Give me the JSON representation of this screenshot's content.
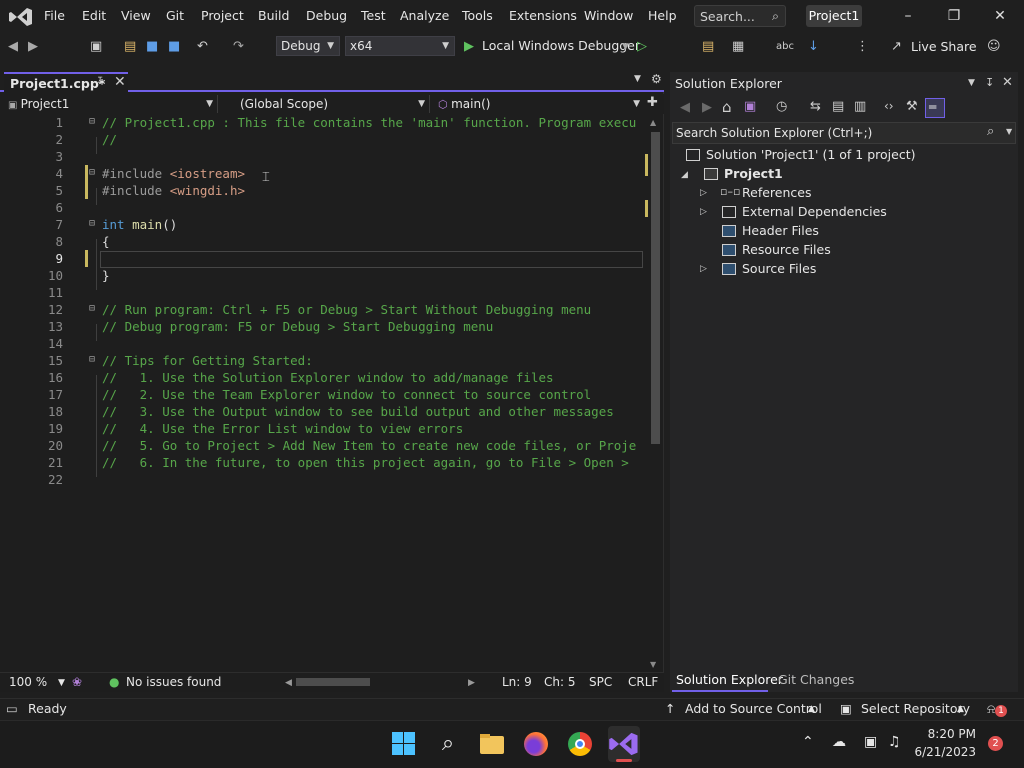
{
  "menu": [
    "File",
    "Edit",
    "View",
    "Git",
    "Project",
    "Build",
    "Debug",
    "Test",
    "Analyze",
    "Tools",
    "Extensions",
    "Window",
    "Help"
  ],
  "search": {
    "placeholder": "Search..."
  },
  "title": {
    "project": "Project1"
  },
  "toolbar": {
    "config": "Debug",
    "platform": "x64",
    "run_target": "Local Windows Debugger",
    "live_share": "Live Share"
  },
  "editor": {
    "tab": "Project1.cpp*",
    "nav": {
      "project": "Project1",
      "scope": "(Global Scope)",
      "member": "main()"
    },
    "lines": [
      {
        "n": "1",
        "t": "// Project1.cpp : This file contains the 'main' function. Program execu"
      },
      {
        "n": "2",
        "t": "//"
      },
      {
        "n": "3",
        "t": ""
      },
      {
        "n": "4",
        "t": "#include <iostream>"
      },
      {
        "n": "5",
        "t": "#include <wingdi.h>"
      },
      {
        "n": "6",
        "t": ""
      },
      {
        "n": "7",
        "t": "int main()"
      },
      {
        "n": "8",
        "t": "{"
      },
      {
        "n": "9",
        "t": ""
      },
      {
        "n": "10",
        "t": "}"
      },
      {
        "n": "11",
        "t": ""
      },
      {
        "n": "12",
        "t": "// Run program: Ctrl + F5 or Debug > Start Without Debugging menu"
      },
      {
        "n": "13",
        "t": "// Debug program: F5 or Debug > Start Debugging menu"
      },
      {
        "n": "14",
        "t": ""
      },
      {
        "n": "15",
        "t": "// Tips for Getting Started:"
      },
      {
        "n": "16",
        "t": "//   1. Use the Solution Explorer window to add/manage files"
      },
      {
        "n": "17",
        "t": "//   2. Use the Team Explorer window to connect to source control"
      },
      {
        "n": "18",
        "t": "//   3. Use the Output window to see build output and other messages"
      },
      {
        "n": "19",
        "t": "//   4. Use the Error List window to view errors"
      },
      {
        "n": "20",
        "t": "//   5. Go to Project > Add New Item to create new code files, or Proje"
      },
      {
        "n": "21",
        "t": "//   6. In the future, to open this project again, go to File > Open >"
      },
      {
        "n": "22",
        "t": ""
      }
    ],
    "zoom": "100 %",
    "issues": "No issues found",
    "ln": "Ln: 9",
    "ch": "Ch: 5",
    "spc": "SPC",
    "eol": "CRLF"
  },
  "solution_explorer": {
    "title": "Solution Explorer",
    "search_placeholder": "Search Solution Explorer (Ctrl+;)",
    "solution": "Solution 'Project1' (1 of 1 project)",
    "project": "Project1",
    "items": [
      "References",
      "External Dependencies",
      "Header Files",
      "Resource Files",
      "Source Files"
    ],
    "tabs": [
      "Solution Explorer",
      "Git Changes"
    ]
  },
  "status": {
    "ready": "Ready",
    "source_control": "Add to Source Control",
    "repository": "Select Repository",
    "notifications": "1"
  },
  "taskbar": {
    "time": "8:20 PM",
    "date": "6/21/2023",
    "badge": "2"
  },
  "colors": {
    "accent": "#7160e8",
    "comment": "#57a64a",
    "keyword": "#569cd6",
    "string": "#d69d85"
  }
}
